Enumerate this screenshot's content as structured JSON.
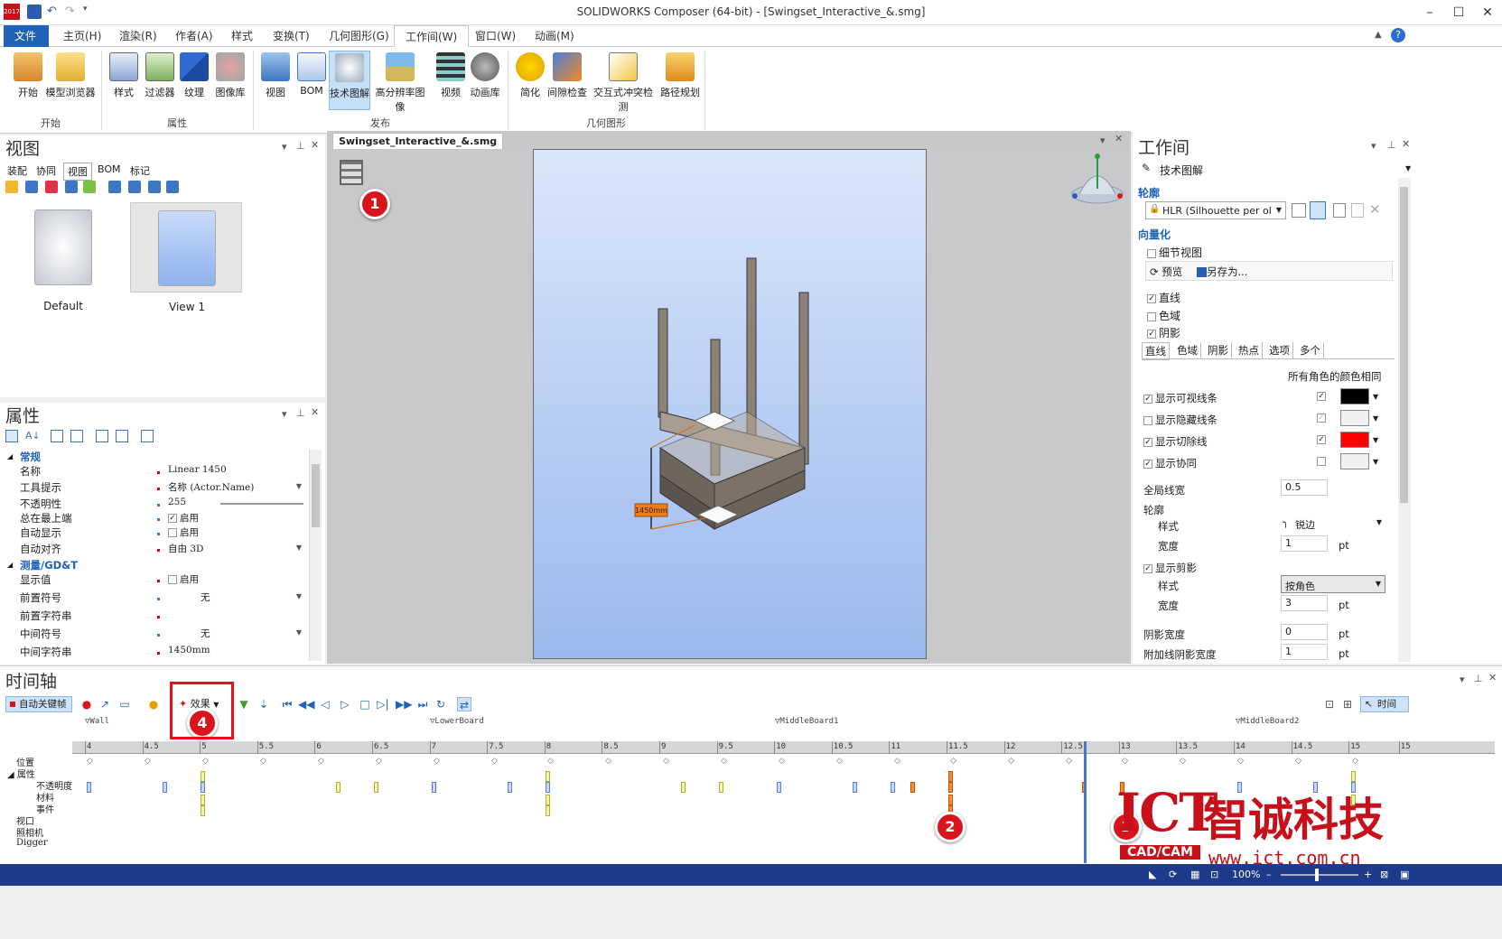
{
  "app": {
    "window_title": "SOLIDWORKS Composer (64-bit) - [Swingset_Interactive_&.smg]",
    "logo_text": "2017"
  },
  "menu": {
    "tabs": [
      {
        "label": "文件"
      },
      {
        "label": "主页(H)"
      },
      {
        "label": "渲染(R)"
      },
      {
        "label": "作者(A)"
      },
      {
        "label": "样式"
      },
      {
        "label": "变换(T)"
      },
      {
        "label": "几何图形(G)"
      },
      {
        "label": "工作间(W)"
      },
      {
        "label": "窗口(W)"
      },
      {
        "label": "动画(M)"
      }
    ],
    "active": "工作间(W)"
  },
  "ribbon": {
    "buttons": [
      {
        "label": "开始"
      },
      {
        "label": "模型浏览器"
      },
      {
        "label": "样式"
      },
      {
        "label": "过滤器"
      },
      {
        "label": "纹理"
      },
      {
        "label": "图像库"
      },
      {
        "label": "视图"
      },
      {
        "label": "BOM"
      },
      {
        "label": "技术图解"
      },
      {
        "label": "高分辨率图像"
      },
      {
        "label": "视频"
      },
      {
        "label": "动画库"
      },
      {
        "label": "简化"
      },
      {
        "label": "间隙检查"
      },
      {
        "label": "交互式冲突检测"
      },
      {
        "label": "路径规划"
      }
    ],
    "groups": [
      {
        "label": "开始"
      },
      {
        "label": "属性"
      },
      {
        "label": "发布"
      },
      {
        "label": "几何图形"
      }
    ]
  },
  "views_panel": {
    "title": "视图",
    "tabs": [
      "装配",
      "协同",
      "视图",
      "BOM",
      "标记"
    ],
    "active_tab": "视图",
    "thumbnails": [
      {
        "caption": "Default"
      },
      {
        "caption": "View 1"
      }
    ]
  },
  "props_panel": {
    "title": "属性",
    "rows": [
      {
        "key": "常规",
        "value": "",
        "category": true
      },
      {
        "key": "名称",
        "value": "Linear 1450"
      },
      {
        "key": "工具提示",
        "value": "名称 (Actor.Name)"
      },
      {
        "key": "不透明性",
        "value": "255"
      },
      {
        "key": "总在最上端",
        "value": "启用",
        "checked": true
      },
      {
        "key": "自动显示",
        "value": "启用",
        "checked": false
      },
      {
        "key": "自动对齐",
        "value": "自由 3D"
      },
      {
        "key": "测量/GD&T",
        "value": "",
        "category": true
      },
      {
        "key": "显示值",
        "value": "启用",
        "checked": false
      },
      {
        "key": "前置符号",
        "value": "无"
      },
      {
        "key": "前置字符串",
        "value": ""
      },
      {
        "key": "中间符号",
        "value": "无"
      },
      {
        "key": "中间字符串",
        "value": "1450mm"
      }
    ]
  },
  "document": {
    "tab_label": "Swingset_Interactive_&.smg",
    "dimension_label": "1450mm"
  },
  "workshop_panel": {
    "title": "工作间",
    "subtitle": "技术图解",
    "section_outline": "轮廓",
    "mode_value": "HLR (Silhouette per ol",
    "section_vector": "向量化",
    "detail_view_label": "细节视图",
    "preview_label": "预览",
    "save_as_label": "另存为...",
    "check_lines": {
      "label": "直线",
      "checked": true
    },
    "check_regions": {
      "label": "色域",
      "checked": false
    },
    "check_shadow": {
      "label": "阴影",
      "checked": true
    },
    "tabs": [
      "直线",
      "色域",
      "阴影",
      "热点",
      "选项",
      "多个"
    ],
    "same_color_label": "所有角色的颜色相同",
    "line_options": [
      {
        "label": "显示可视线条",
        "checked": true,
        "color": "#000000"
      },
      {
        "label": "显示隐藏线条",
        "checked": false,
        "color": "#f0f0f0"
      },
      {
        "label": "显示切除线",
        "checked": true,
        "color": "#ff0000"
      },
      {
        "label": "显示协同",
        "checked": true,
        "color": "#f0f0f0"
      }
    ],
    "global_width_label": "全局线宽",
    "global_width_value": "0.5",
    "outline_label": "轮廓",
    "style_label": "样式",
    "style_value": "锐边",
    "width_label": "宽度",
    "width_value": "1",
    "unit": "pt",
    "show_clip_label": "显示剪影",
    "clip_style_label": "样式",
    "clip_style_value": "按角色",
    "clip_width_label": "宽度",
    "clip_width_value": "3",
    "shadow_width_label": "阴影宽度",
    "shadow_width_value": "0",
    "extra_shadow_label": "附加线阴影宽度",
    "extra_shadow_value": "1"
  },
  "timeline": {
    "title": "时间轴",
    "auto_key_label": "自动关键帧",
    "effect_label": "效果",
    "time_label": "时间",
    "markers": [
      "Wall",
      "LowerBoard",
      "MiddleBoard1",
      "MiddleBoard2"
    ],
    "ticks": [
      "4",
      "4.5",
      "5",
      "5.5",
      "6",
      "6.5",
      "7",
      "7.5",
      "8",
      "8.5",
      "9",
      "9.5",
      "10",
      "10.5",
      "11",
      "11.5",
      "12",
      "12.5",
      "13",
      "13.5",
      "14",
      "14.5",
      "15",
      "15"
    ],
    "row_labels": [
      "位置",
      "属性",
      "不透明度",
      "材料",
      "事件",
      "视口",
      "照相机",
      "Digger"
    ]
  },
  "callouts": [
    "1",
    "2",
    "3",
    "4"
  ],
  "status": {
    "zoom": "100%"
  },
  "watermark": {
    "text1": "ICT",
    "text2": "智诚科技",
    "text3": "CAD/CAM",
    "text4": "www.ict.com.cn"
  },
  "colors": {
    "accent": "#1e63b8",
    "callout_red": "#d9141b",
    "status_bar": "#1e3a8a"
  }
}
